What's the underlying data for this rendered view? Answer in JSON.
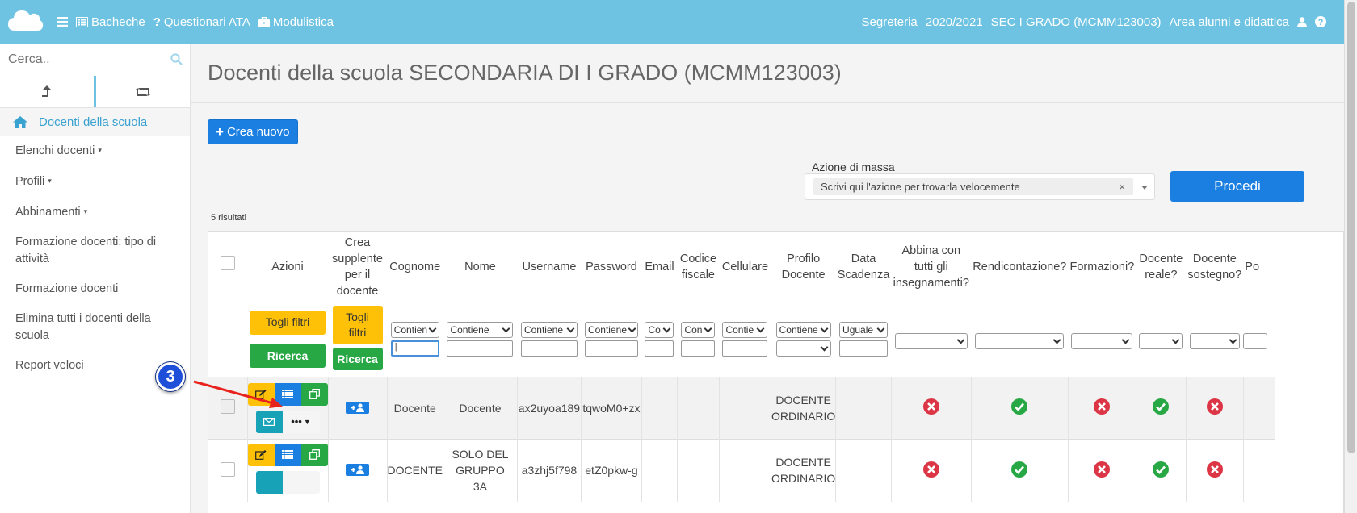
{
  "topbar": {
    "nav": [
      {
        "label": "Bacheche",
        "icon": "board-icon"
      },
      {
        "label": "Questionari ATA",
        "icon": "question-icon"
      },
      {
        "label": "Modulistica",
        "icon": "briefcase-icon"
      }
    ],
    "right": [
      "Segreteria",
      "2020/2021",
      "SEC I GRADO (MCMM123003)",
      "Area alunni e didattica"
    ]
  },
  "sidebar": {
    "search_placeholder": "Cerca..",
    "active_item": "Docenti della scuola",
    "items": [
      {
        "label": "Elenchi docenti",
        "caret": "▾"
      },
      {
        "label": "Profili",
        "caret": "▾"
      },
      {
        "label": "Abbinamenti",
        "caret": "▾"
      },
      {
        "label": "Formazione docenti: tipo di attività",
        "caret": ""
      },
      {
        "label": "Formazione docenti",
        "caret": ""
      },
      {
        "label": "Elimina tutti i docenti della scuola",
        "caret": ""
      },
      {
        "label": "Report veloci",
        "caret": ""
      }
    ]
  },
  "main": {
    "title": "Docenti della scuola SECONDARIA DI I GRADO (MCMM123003)",
    "new_button": "Crea nuovo",
    "mass_action": {
      "label": "Azione di massa",
      "selected": "Scrivi qui l'azione per trovarla velocemente",
      "clear": "×"
    },
    "proceed_button": "Procedi",
    "results_count": "5 risultati"
  },
  "table": {
    "headers": {
      "azioni": "Azioni",
      "crea_supplente": "Crea supplente per il docente",
      "cognome": "Cognome",
      "nome": "Nome",
      "username": "Username",
      "password": "Password",
      "email": "Email",
      "codice_fiscale": "Codice fiscale",
      "cellulare": "Cellulare",
      "profilo": "Profilo Docente",
      "data_scadenza": "Data Scadenza",
      "abbina": "Abbina con tutti gli insegnamenti?",
      "rendicontazione": "Rendicontazione?",
      "formazioni": "Formazioni?",
      "reale": "Docente reale?",
      "sostegno": "Docente sostegno?",
      "po": "Po"
    },
    "filters": {
      "togli_filtri": "Togli filtri",
      "ricerca": "Ricerca",
      "cognome": "Contien",
      "nome": "Contiene",
      "username": "Contiene",
      "password": "Contiene",
      "email": "Co",
      "codice_fiscale": "Con",
      "cellulare": "Contie",
      "profilo": "Contiene",
      "data_scadenza": "Uguale",
      "cognome_value": "|"
    },
    "more_label": "•••",
    "rows": [
      {
        "cognome": "Docente",
        "nome": "Docente",
        "username": "ax2uyoa189",
        "password": "tqwoM0+zx",
        "profilo": "DOCENTE ORDINARIO",
        "abbina": false,
        "rendicontazione": true,
        "formazioni": false,
        "reale": true,
        "sostegno": false
      },
      {
        "cognome": "DOCENTE",
        "nome": "SOLO DEL GRUPPO 3A",
        "username": "a3zhj5f798",
        "password": "etZ0pkw-g",
        "profilo": "DOCENTE ORDINARIO",
        "abbina": false,
        "rendicontazione": true,
        "formazioni": false,
        "reale": true,
        "sostegno": false
      }
    ]
  },
  "annotation": {
    "step": "3"
  },
  "colors": {
    "topbar": "#6ec3e2",
    "primary": "#1a7fe0",
    "warning": "#ffc107",
    "success": "#28a745",
    "danger": "#dc3545",
    "info": "#17a2b8"
  }
}
